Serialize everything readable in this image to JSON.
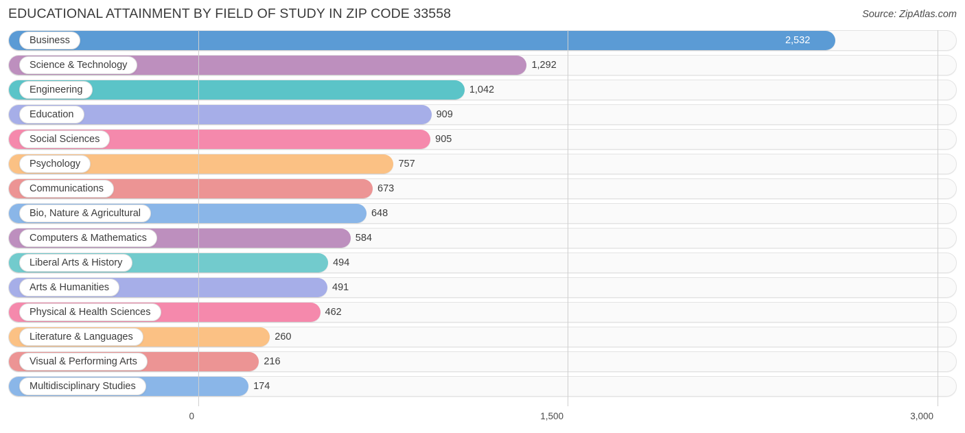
{
  "header": {
    "title": "EDUCATIONAL ATTAINMENT BY FIELD OF STUDY IN ZIP CODE 33558",
    "source": "Source: ZipAtlas.com"
  },
  "chart_data": {
    "type": "bar",
    "orientation": "horizontal",
    "title": "EDUCATIONAL ATTAINMENT BY FIELD OF STUDY IN ZIP CODE 33558",
    "subtitle": "Source: ZipAtlas.com",
    "xlabel": "",
    "ylabel": "",
    "xlim": [
      0,
      3000
    ],
    "grid": true,
    "legend": false,
    "xticks": [
      0,
      1500,
      3000
    ],
    "xtick_labels": [
      "0",
      "1,500",
      "3,000"
    ],
    "categories": [
      "Business",
      "Science & Technology",
      "Engineering",
      "Education",
      "Social Sciences",
      "Psychology",
      "Communications",
      "Bio, Nature & Agricultural",
      "Computers & Mathematics",
      "Liberal Arts & History",
      "Arts & Humanities",
      "Physical & Health Sciences",
      "Literature & Languages",
      "Visual & Performing Arts",
      "Multidisciplinary Studies"
    ],
    "values": [
      2532,
      1292,
      1042,
      909,
      905,
      757,
      673,
      648,
      584,
      494,
      491,
      462,
      260,
      216,
      174
    ],
    "value_labels": [
      "2,532",
      "1,292",
      "1,042",
      "909",
      "905",
      "757",
      "673",
      "648",
      "584",
      "494",
      "491",
      "462",
      "260",
      "216",
      "174"
    ],
    "colors": [
      "#5b9bd5",
      "#bd8fbe",
      "#5bc4c8",
      "#a6aee8",
      "#f589ac",
      "#fbc184",
      "#ec9494",
      "#8ab6e8",
      "#bd8fbe",
      "#72cbcd",
      "#a6aee8",
      "#f589ac",
      "#fbc184",
      "#ec9494",
      "#8ab6e8"
    ]
  }
}
